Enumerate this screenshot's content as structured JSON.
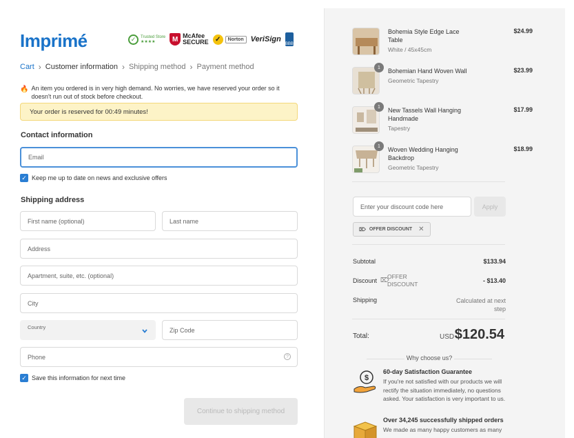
{
  "brand": {
    "name": "Imprimé"
  },
  "trust_badges": [
    {
      "icon": "trusted-store-icon",
      "label": "Trusted Store"
    },
    {
      "icon": "mcafee-shield-icon",
      "label": "McAfee SECURE"
    },
    {
      "icon": "norton-icon",
      "label": "Norton"
    },
    {
      "icon": "verisign-icon",
      "label": "VeriSign"
    },
    {
      "icon": "bbb-icon",
      "label": ""
    }
  ],
  "breadcrumb": {
    "cart": "Cart",
    "customer_information": "Customer information",
    "shipping_method": "Shipping method",
    "payment_method": "Payment method"
  },
  "demand_notice": "An item you ordered is in very high demand. No worries, we have reserved your order so it doesn't run out of stock before checkout.",
  "reserved_notice": "Your order is reserved for 00:49 minutes!",
  "contact": {
    "title": "Contact information",
    "email_placeholder": "Email",
    "newsletter_label": "Keep me up to date on news and exclusive offers",
    "newsletter_checked": true
  },
  "shipping": {
    "title": "Shipping address",
    "first_name_placeholder": "First name (optional)",
    "last_name_placeholder": "Last name",
    "address_placeholder": "Address",
    "apartment_placeholder": "Apartment, suite, etc. (optional)",
    "city_placeholder": "City",
    "country_label": "Country",
    "zip_placeholder": "Zip Code",
    "phone_placeholder": "Phone",
    "save_info_label": "Save this information for next time",
    "save_info_checked": true
  },
  "continue_button": "Continue to shipping method",
  "order_items": [
    {
      "name": "Bohemia Style Edge Lace Table",
      "variant": "White / 45x45cm",
      "price": "$24.99",
      "qty": ""
    },
    {
      "name": "Bohemian Hand Woven Wall",
      "variant": "Geometric Tapestry",
      "price": "$23.99",
      "qty": "1"
    },
    {
      "name": "New Tassels Wall Hanging Handmade",
      "variant": "Tapestry",
      "price": "$17.99",
      "qty": "1"
    },
    {
      "name": "Woven Wedding Hanging Backdrop",
      "variant": "Geometric Tapestry",
      "price": "$18.99",
      "qty": "1"
    }
  ],
  "discount": {
    "placeholder": "Enter your discount code here",
    "apply_label": "Apply",
    "tag_label": "OFFER DISCOUNT"
  },
  "summary": {
    "subtotal_label": "Subtotal",
    "subtotal_value": "$133.94",
    "discount_label": "Discount",
    "discount_code": "OFFER DISCOUNT",
    "discount_value": "- $13.40",
    "shipping_label": "Shipping",
    "shipping_value": "Calculated at next step",
    "total_label": "Total:",
    "total_currency": "USD",
    "total_value": "$120.54"
  },
  "why_choose": {
    "title": "Why choose us?",
    "items": [
      {
        "icon": "money-hand-icon",
        "title": "60-day Satisfaction Guarantee",
        "text": "If you're not satisfied with our products we will rectify the situation immediately, no questions asked. Your satisfaction is very important to us."
      },
      {
        "icon": "shipping-box-icon",
        "title": "Over 34,245 successfully shipped orders",
        "text": "We made as many happy customers as many"
      }
    ]
  },
  "colors": {
    "brand_blue": "#1a73c9",
    "focus_border": "#4a90d9",
    "notice_bg": "#fdf3c7",
    "sidebar_bg": "#f4f4f4"
  }
}
